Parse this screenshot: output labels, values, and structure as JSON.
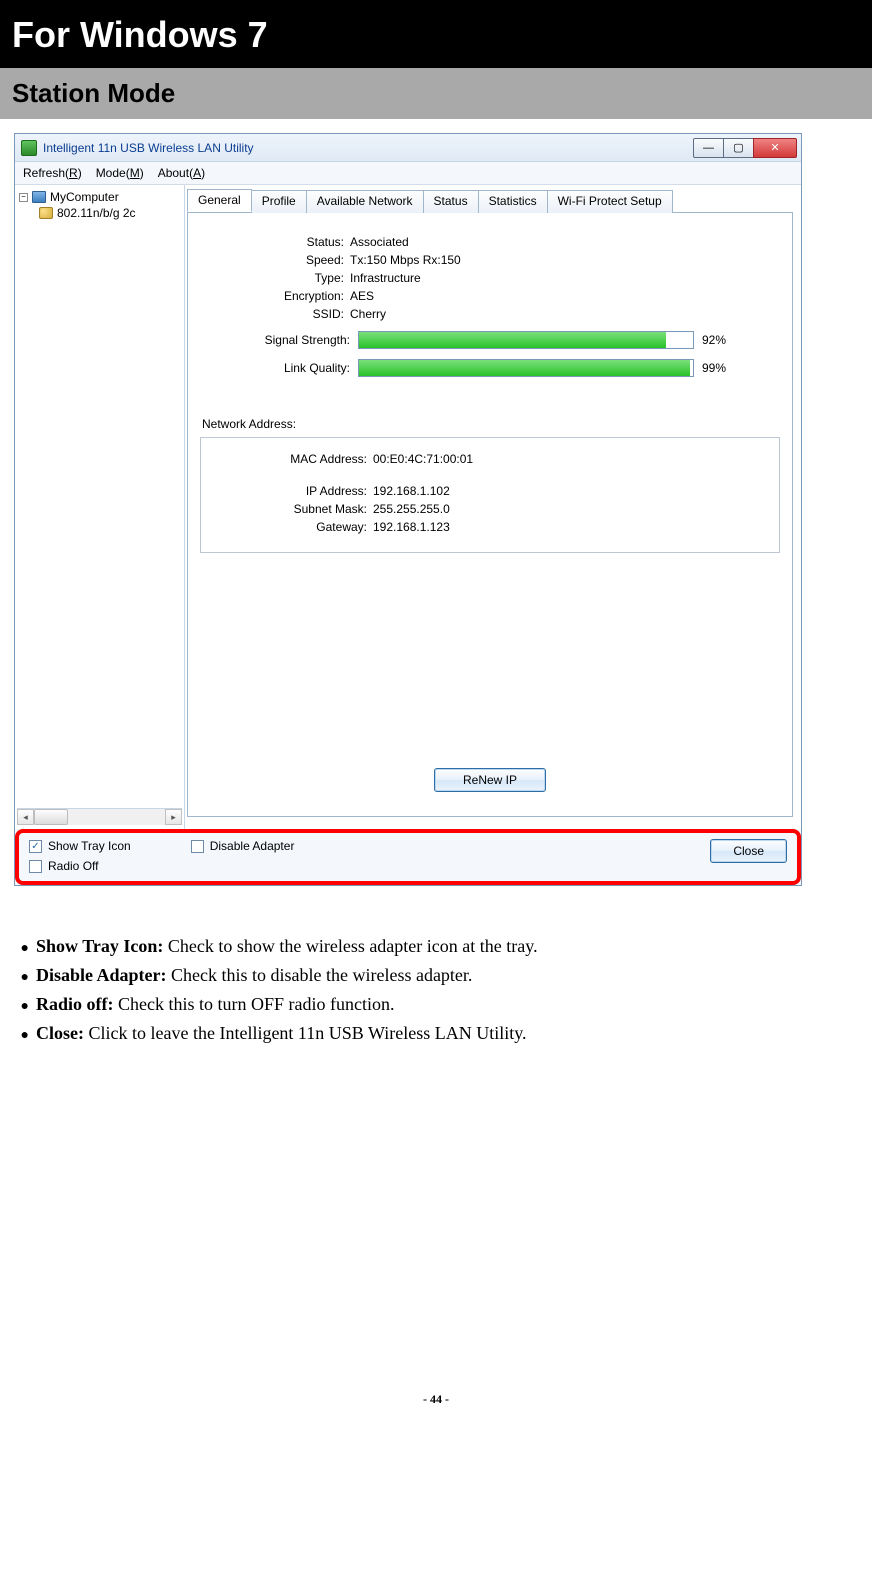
{
  "headings": {
    "h1": "For Windows 7",
    "h2": "Station Mode"
  },
  "window": {
    "title": "Intelligent 11n USB Wireless LAN Utility",
    "menus": {
      "refresh": "Refresh(R)",
      "mode": "Mode(M)",
      "about": "About(A)"
    },
    "tree": {
      "root": "MyComputer",
      "adapter": "802.11n/b/g 2c"
    },
    "tabs": {
      "general": "General",
      "profile": "Profile",
      "available": "Available Network",
      "status": "Status",
      "statistics": "Statistics",
      "wps": "Wi-Fi Protect Setup"
    },
    "general": {
      "labels": {
        "status": "Status:",
        "speed": "Speed:",
        "type": "Type:",
        "encryption": "Encryption:",
        "ssid": "SSID:",
        "signal": "Signal Strength:",
        "link": "Link Quality:",
        "netaddr_title": "Network Address:",
        "mac": "MAC Address:",
        "ip": "IP Address:",
        "subnet": "Subnet Mask:",
        "gateway": "Gateway:"
      },
      "values": {
        "status": "Associated",
        "speed": "Tx:150 Mbps Rx:150",
        "type": "Infrastructure",
        "encryption": "AES",
        "ssid": "Cherry",
        "signal_pct": "92%",
        "link_pct": "99%",
        "mac": "00:E0:4C:71:00:01",
        "ip": "192.168.1.102",
        "subnet": "255.255.255.0",
        "gateway": "192.168.1.123"
      },
      "renew_button": "ReNew IP"
    },
    "footer": {
      "show_tray": "Show Tray Icon",
      "radio_off": "Radio Off",
      "disable_adapter": "Disable Adapter",
      "close": "Close"
    }
  },
  "bullets": [
    {
      "term": "Show Tray Icon:",
      "desc": " Check to show the wireless adapter icon at the tray."
    },
    {
      "term": "Disable Adapter:",
      "desc": " Check this to disable the wireless adapter."
    },
    {
      "term": "Radio off:",
      "desc": " Check this to turn OFF radio function."
    },
    {
      "term": "Close:",
      "desc": " Click to leave the Intelligent 11n USB Wireless LAN Utility."
    }
  ],
  "page_number": "- 44 -"
}
